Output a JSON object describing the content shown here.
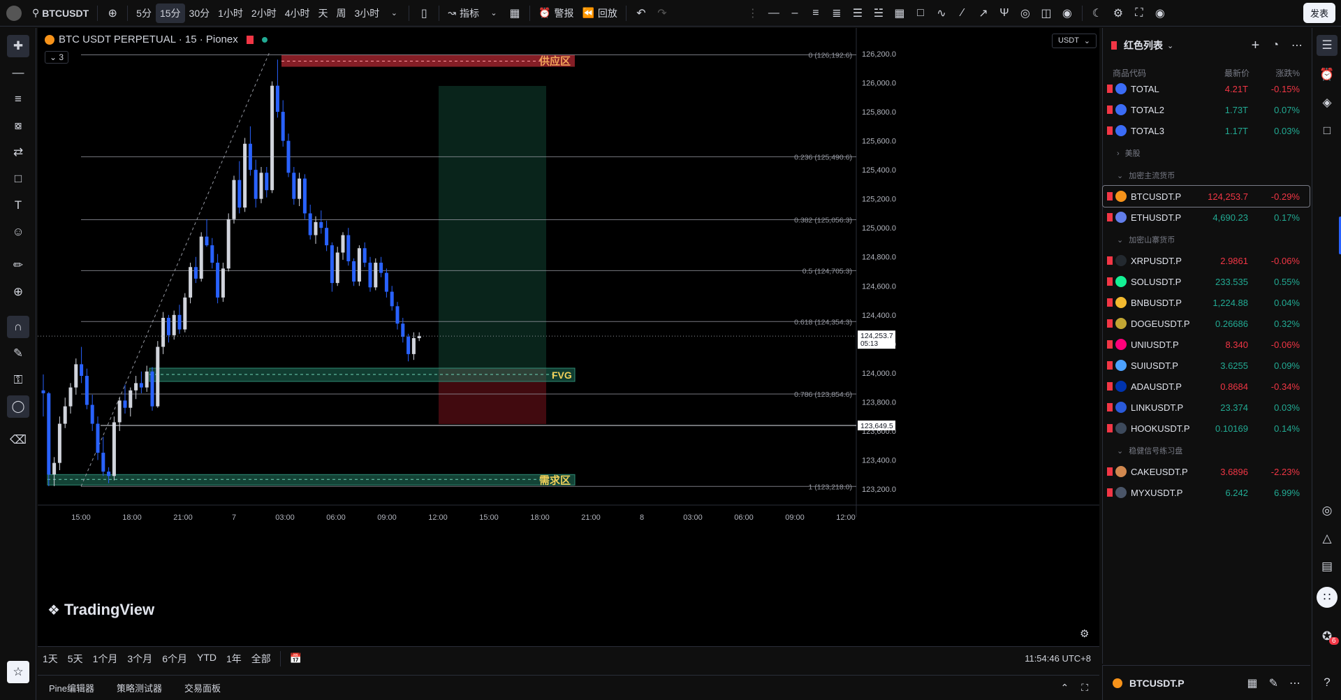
{
  "topbar": {
    "symbol": "BTCUSDT",
    "intervals": [
      "5分",
      "15分",
      "30分",
      "1小时",
      "2小时",
      "4小时",
      "天",
      "周",
      "3小时"
    ],
    "active_interval": "15分",
    "indicators_label": "指标",
    "alert_label": "警报",
    "replay_label": "回放",
    "publish_label": "发表"
  },
  "chart": {
    "title": "BTC USDT PERPETUAL · 15 · Pionex",
    "indicator_count": "3",
    "currency_select": "USDT",
    "watermark": "TradingView",
    "zones": {
      "supply": "供应区",
      "fvg": "FVG",
      "demand": "需求区"
    },
    "fib_levels": [
      {
        "label": "0 (126,192.6)",
        "price": 126192.6
      },
      {
        "label": "0.236 (125,490.6)",
        "price": 125490.6
      },
      {
        "label": "0.382 (125,056.3)",
        "price": 125056.3
      },
      {
        "label": "0.5 (124,705.3)",
        "price": 124705.3
      },
      {
        "label": "0.618 (124,354.3)",
        "price": 124354.3
      },
      {
        "label": "0.786 (123,854.6)",
        "price": 123854.6
      },
      {
        "label": "1 (123,218.0)",
        "price": 123218.0
      }
    ],
    "price_axis_ticks": [
      "126,200.0",
      "126,000.0",
      "125,800.0",
      "125,600.0",
      "125,400.0",
      "125,200.0",
      "125,000.0",
      "124,800.0",
      "124,600.0",
      "124,400.0",
      "124,200.0",
      "124,000.0",
      "123,800.0",
      "123,600.0",
      "123,400.0",
      "123,200.0"
    ],
    "current_price": "124,253.7",
    "countdown": "05:13",
    "hline_price": "123,649.5",
    "time_axis_ticks": [
      "15:00",
      "18:00",
      "21:00",
      "7",
      "03:00",
      "06:00",
      "09:00",
      "12:00",
      "15:00",
      "18:00",
      "21:00",
      "8",
      "03:00",
      "06:00",
      "09:00",
      "12:00"
    ],
    "colors": {
      "bull": "#d1d4dc",
      "bear": "#2962ff",
      "supply": "#b22833",
      "fvg": "#1f6f5a",
      "demand": "#1f6f5a"
    }
  },
  "rangebar": {
    "ranges": [
      "1天",
      "5天",
      "1个月",
      "3个月",
      "6个月",
      "YTD",
      "1年",
      "全部"
    ],
    "clock": "11:54:46 UTC+8"
  },
  "panelbar": {
    "tabs": [
      "Pine编辑器",
      "策略测试器",
      "交易面板"
    ]
  },
  "watchlist": {
    "title": "红色列表",
    "col_symbol": "商品代码",
    "col_last": "最新价",
    "col_change": "涨跌%",
    "groups": {
      "us": "美股",
      "major": "加密主流货币",
      "alt": "加密山寨货币",
      "signal": "稳健信号练习盘"
    },
    "rows_top": [
      {
        "sym": "TOTAL",
        "last": "4.21T",
        "chg": "-0.15%",
        "dir": "down",
        "icon": "#3b6cf6"
      },
      {
        "sym": "TOTAL2",
        "last": "1.73T",
        "chg": "0.07%",
        "dir": "up",
        "icon": "#3b6cf6"
      },
      {
        "sym": "TOTAL3",
        "last": "1.17T",
        "chg": "0.03%",
        "dir": "up",
        "icon": "#3b6cf6"
      }
    ],
    "rows_major": [
      {
        "sym": "BTCUSDT.P",
        "last": "124,253.7",
        "chg": "-0.29%",
        "dir": "down",
        "icon": "#f7931a"
      },
      {
        "sym": "ETHUSDT.P",
        "last": "4,690.23",
        "chg": "0.17%",
        "dir": "up",
        "icon": "#627eea"
      }
    ],
    "rows_alt": [
      {
        "sym": "XRPUSDT.P",
        "last": "2.9861",
        "chg": "-0.06%",
        "dir": "down",
        "icon": "#23292f"
      },
      {
        "sym": "SOLUSDT.P",
        "last": "233.535",
        "chg": "0.55%",
        "dir": "up",
        "icon": "#14f195"
      },
      {
        "sym": "BNBUSDT.P",
        "last": "1,224.88",
        "chg": "0.04%",
        "dir": "up",
        "icon": "#f3ba2f"
      },
      {
        "sym": "DOGEUSDT.P",
        "last": "0.26686",
        "chg": "0.32%",
        "dir": "up",
        "icon": "#c2a633"
      },
      {
        "sym": "UNIUSDT.P",
        "last": "8.340",
        "chg": "-0.06%",
        "dir": "down",
        "icon": "#ff007a"
      },
      {
        "sym": "SUIUSDT.P",
        "last": "3.6255",
        "chg": "0.09%",
        "dir": "up",
        "icon": "#4da2ff"
      },
      {
        "sym": "ADAUSDT.P",
        "last": "0.8684",
        "chg": "-0.34%",
        "dir": "down",
        "icon": "#0033ad"
      },
      {
        "sym": "LINKUSDT.P",
        "last": "23.374",
        "chg": "0.03%",
        "dir": "up",
        "icon": "#2a5ada"
      },
      {
        "sym": "HOOKUSDT.P",
        "last": "0.10169",
        "chg": "0.14%",
        "dir": "up",
        "icon": "#3d4a5c"
      }
    ],
    "rows_signal": [
      {
        "sym": "CAKEUSDT.P",
        "last": "3.6896",
        "chg": "-2.23%",
        "dir": "down",
        "icon": "#d1884f"
      },
      {
        "sym": "MYXUSDT.P",
        "last": "6.242",
        "chg": "6.99%",
        "dir": "up",
        "icon": "#4a5568"
      }
    ],
    "footer_symbol": "BTCUSDT.P",
    "notification_count": "6"
  }
}
